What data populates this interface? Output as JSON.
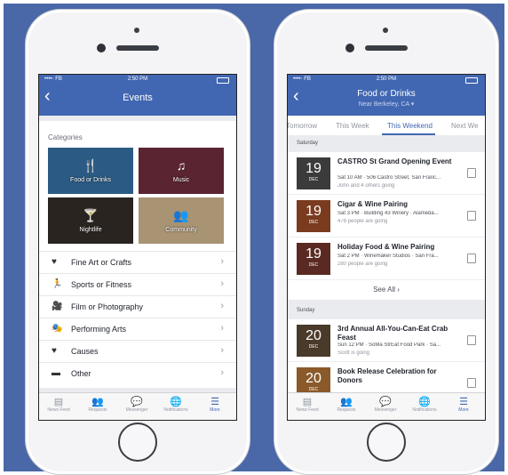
{
  "left": {
    "status": {
      "carrier": "••••◦ FB ",
      "time": "2:50 PM"
    },
    "title": "Events",
    "categories_heading": "Categories",
    "tiles": [
      {
        "label": "Food or Drinks",
        "icon": "🍴",
        "color": "#2b5b84"
      },
      {
        "label": "Music",
        "icon": "♫",
        "color": "#5a2430"
      },
      {
        "label": "Nightlife",
        "icon": "🍸",
        "color": "#2a2420"
      },
      {
        "label": "Community",
        "icon": "👥",
        "color": "#a89373"
      }
    ],
    "rows": [
      {
        "icon": "♥",
        "label": "Fine Art or Crafts"
      },
      {
        "icon": "🏃",
        "label": "Sports or Fitness"
      },
      {
        "icon": "🎥",
        "label": "Film or Photography"
      },
      {
        "icon": "🎭",
        "label": "Performing Arts"
      },
      {
        "icon": "♥",
        "label": "Causes"
      },
      {
        "icon": "▬",
        "label": "Other"
      }
    ]
  },
  "right": {
    "status": {
      "carrier": "••••◦ FB ",
      "time": "2:50 PM"
    },
    "title": "Food or Drinks",
    "subtitle": "Near Berkeley, CA ▾",
    "weeks": [
      "Tomorrow",
      "This Week",
      "This Weekend",
      "Next We"
    ],
    "saturday": "Saturday",
    "sunday": "Sunday",
    "see_all": "See All ›",
    "events": [
      {
        "day": "19",
        "month": "DEC",
        "title": "CASTRO St Grand Opening Event",
        "detail": "Sat 10 AM · 506 Castro Street, San Franc...",
        "going": "John and 4 others going",
        "color": "#3b3b3b"
      },
      {
        "day": "19",
        "month": "DEC",
        "title": "Cigar & Wine Pairing",
        "detail": "Sat 3 PM · Building 43 Winery · Alameda...",
        "going": "478 people are going",
        "color": "#7a3b1f"
      },
      {
        "day": "19",
        "month": "DEC",
        "title": "Holiday Food & Wine Pairing",
        "detail": "Sat 2 PM · Winemaker Studios · San Fra...",
        "going": "280 people are going",
        "color": "#5a2a22"
      },
      {
        "day": "20",
        "month": "DEC",
        "title": "3rd Annual All-You-Can-Eat Crab Feast",
        "detail": "Sun 12 PM · SoMa StrEat Food Park · Sa...",
        "going": "Scott is going",
        "color": "#4a3a2a"
      },
      {
        "day": "20",
        "month": "DEC",
        "title": "Book Release Celebration for Donors",
        "detail": "",
        "going": "",
        "color": "#8a5a2a"
      }
    ]
  },
  "tabbar": [
    {
      "icon": "▤",
      "label": "News Feed"
    },
    {
      "icon": "👥",
      "label": "Requests"
    },
    {
      "icon": "💬",
      "label": "Messenger"
    },
    {
      "icon": "🌐",
      "label": "Notifications"
    },
    {
      "icon": "☰",
      "label": "More"
    }
  ]
}
